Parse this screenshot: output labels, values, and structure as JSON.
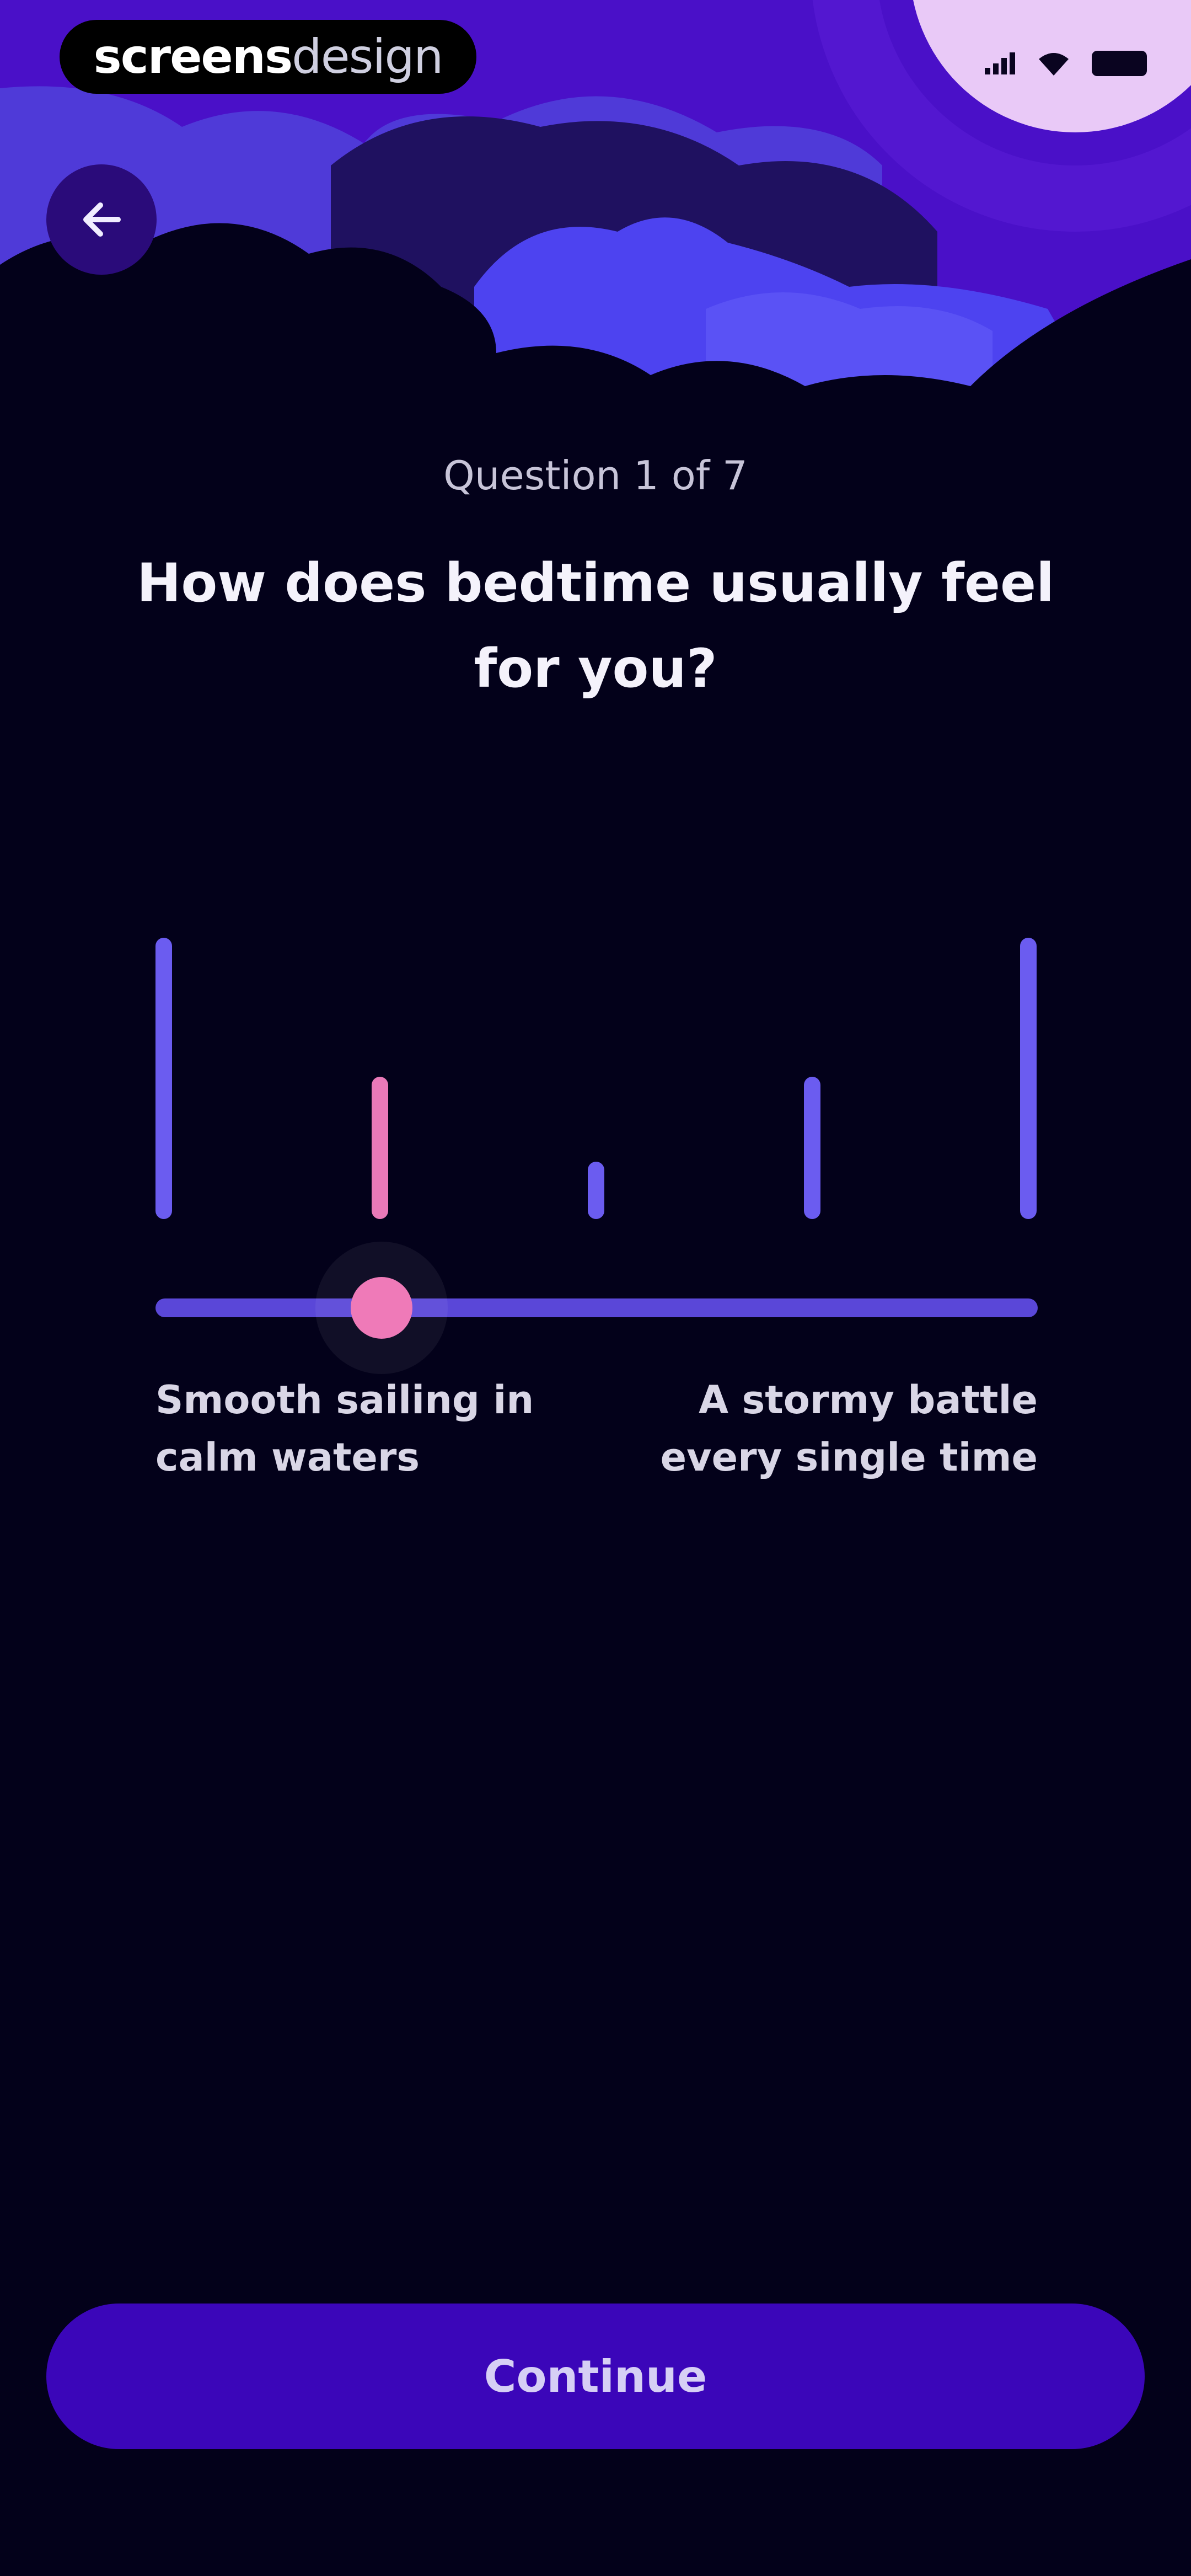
{
  "watermark": {
    "bold": "screens",
    "light": "design"
  },
  "progress": {
    "label": "Question 1 of 7",
    "current": 1,
    "total": 7
  },
  "question": {
    "title": "How does bedtime usually feel for you?"
  },
  "slider": {
    "steps": 5,
    "selected_step": 2,
    "value_fraction": 0.25,
    "left_label": "Smooth sailing in calm waters",
    "right_label": "A stormy battle every single time"
  },
  "actions": {
    "continue_label": "Continue"
  },
  "colors": {
    "background": "#03011a",
    "accent": "#3b06b9",
    "bar": "#6b5cf0",
    "active": "#ef7ab8"
  },
  "icons": {
    "back": "arrow-left-icon",
    "signal": "signal-icon",
    "wifi": "wifi-icon",
    "battery": "battery-icon"
  }
}
